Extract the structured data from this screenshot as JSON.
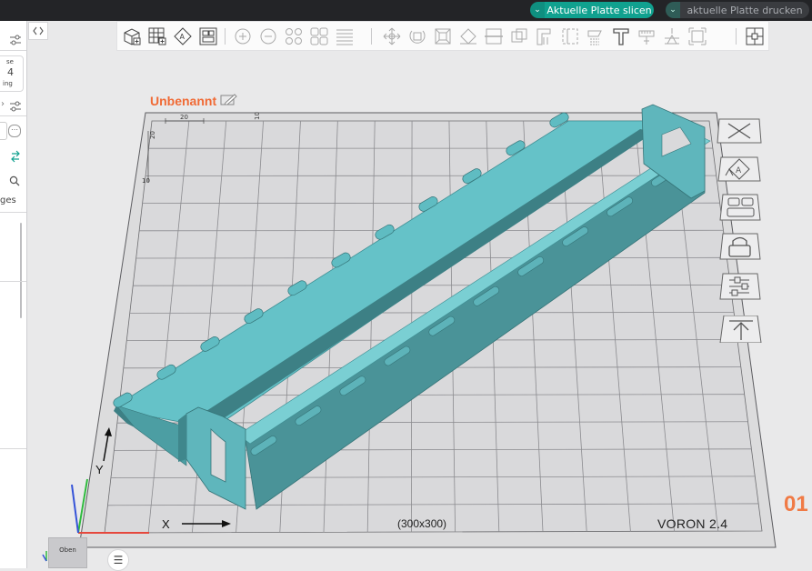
{
  "toolbar_top": {
    "slice_button": "Aktuelle Platte slicen",
    "print_button": "aktuelle Platte drucken",
    "dropdown_glyph": "⌄"
  },
  "left_panel": {
    "fragment_1": "se",
    "fragment_2": "4",
    "fragment_3": "ing",
    "fragment_4": "ges",
    "more_glyph": "⋯"
  },
  "viewport": {
    "project_title": "Unbenannt",
    "plate_size": "(300x300)",
    "printer_name": "VORON 2.4",
    "plate_number": "01",
    "axis_x": "X",
    "axis_y": "Y",
    "ruler_labels": [
      "20",
      "10",
      "20",
      "10"
    ]
  },
  "view_cube": {
    "label": "Oben"
  },
  "menu_button": {
    "glyph": "☰"
  },
  "collapse_button": {
    "glyph": "< >"
  },
  "colors": {
    "accent": "#10a18f",
    "model": "#5ec0c6",
    "brand_orange": "#f06a35",
    "topbar": "#232427"
  }
}
